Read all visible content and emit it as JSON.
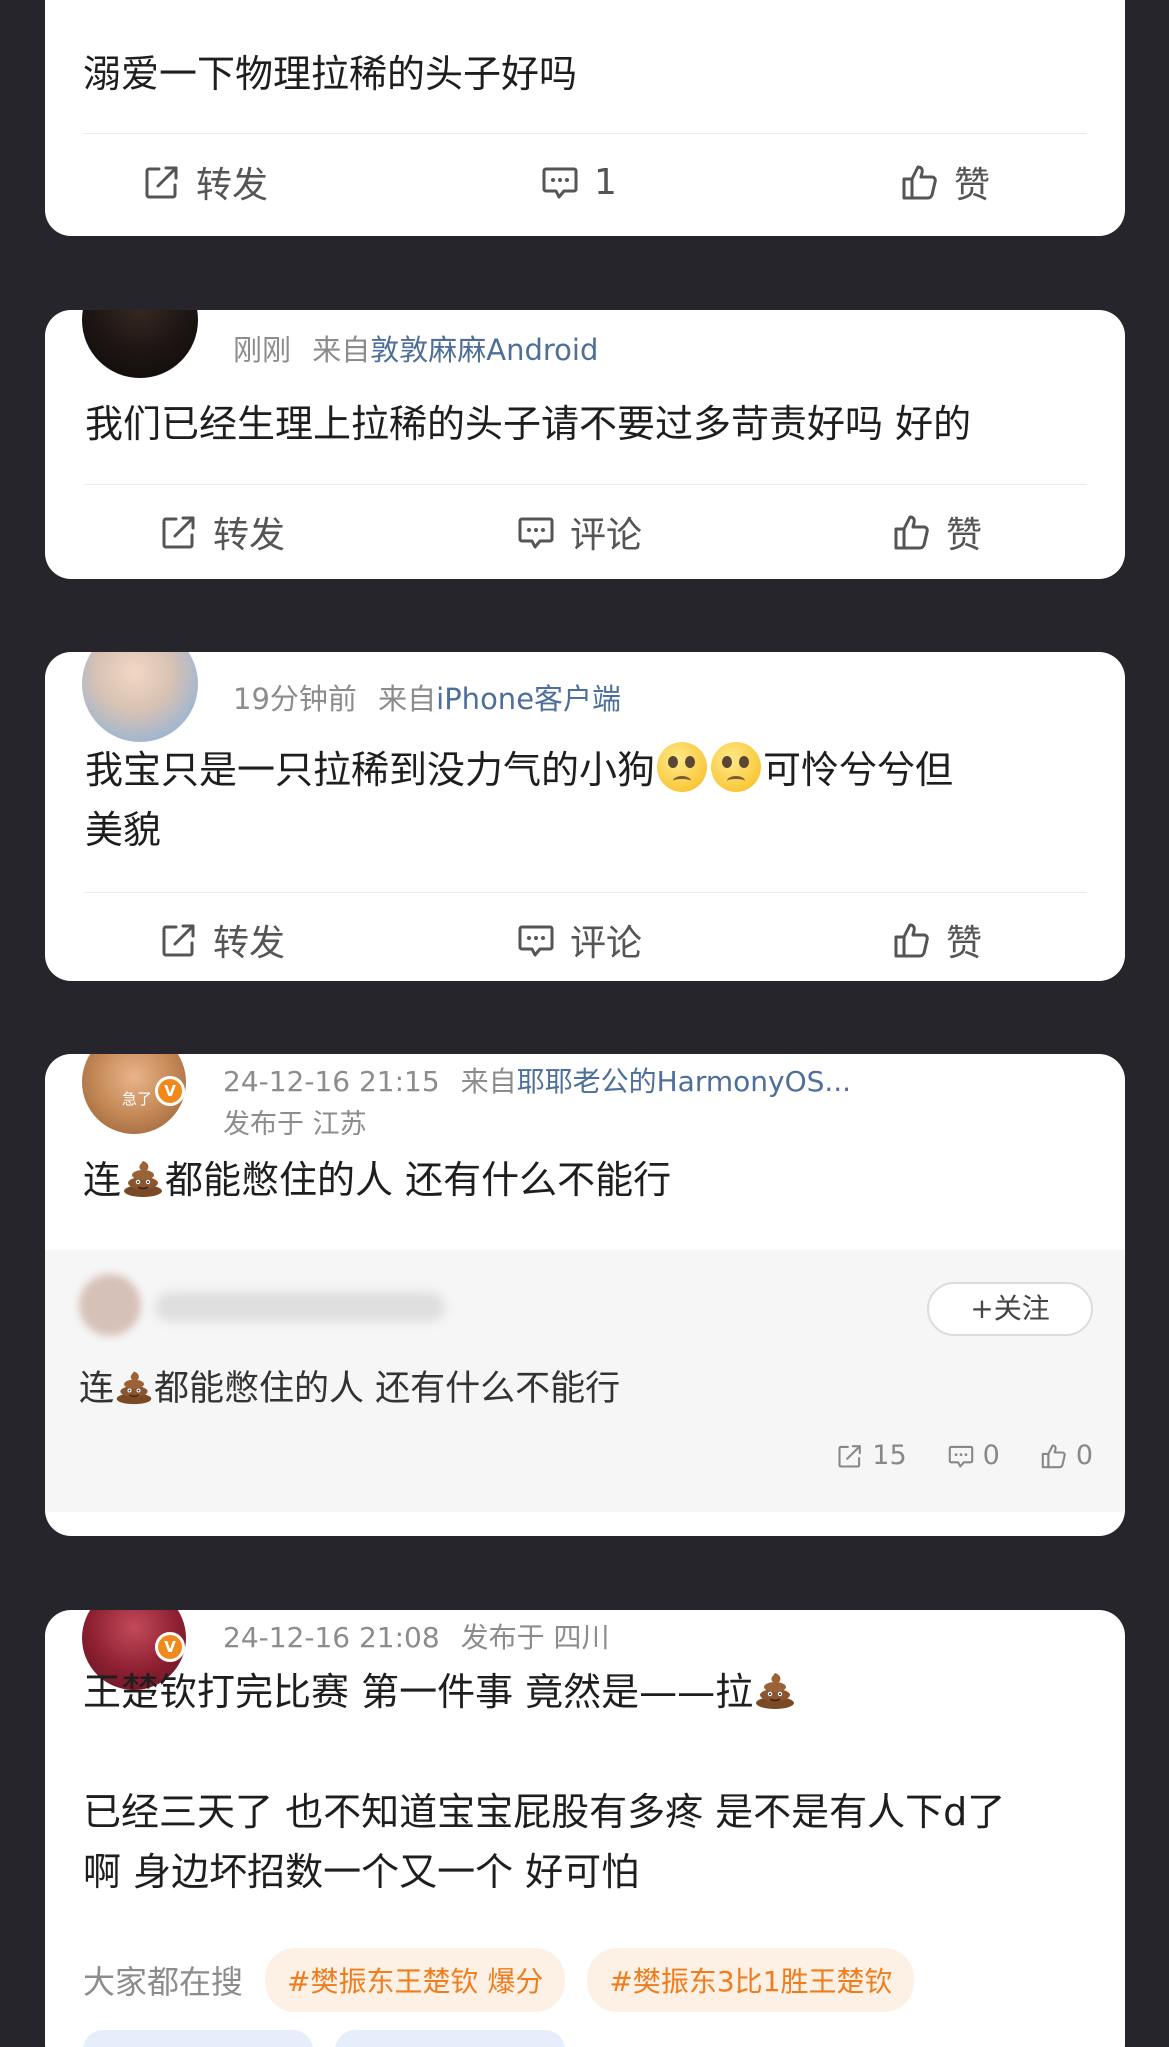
{
  "posts": [
    {
      "text": "溺爱一下物理拉稀的头子好吗",
      "actions": {
        "repost": "转发",
        "comment": "1",
        "like": "赞"
      }
    },
    {
      "time": "刚刚",
      "source_prefix": "来自",
      "source": "敦敦麻麻Android",
      "text": "我们已经生理上拉稀的头子请不要过多苛责好吗 好的",
      "actions": {
        "repost": "转发",
        "comment": "评论",
        "like": "赞"
      }
    },
    {
      "time": "19分钟前",
      "source_prefix": "来自",
      "source": "iPhone客户端",
      "text_a": "我宝只是一只拉稀到没力气的小狗",
      "text_b": "可怜兮兮但",
      "text_c": "美貌",
      "actions": {
        "repost": "转发",
        "comment": "评论",
        "like": "赞"
      }
    },
    {
      "avatar_text": "急了",
      "verified_badge": "V",
      "time": "24-12-16 21:15",
      "source_prefix": "来自",
      "source": "耶耶老公的HarmonyOS...",
      "location": "发布于 江苏",
      "text_a": "连",
      "text_b": "都能憋住的人 还有什么不能行",
      "repost": {
        "follow_label": "+关注",
        "text_a": "连",
        "text_b": "都能憋住的人 还有什么不能行",
        "repost_count": "15",
        "comment_count": "0",
        "like_count": "0"
      }
    },
    {
      "verified_badge": "V",
      "time": "24-12-16 21:08",
      "location": "发布于 四川",
      "text_line1": "王楚钦打完比赛 第一件事 竟然是——拉",
      "text_line2": "已经三天了 也不知道宝宝屁股有多疼 是不是有人下d了",
      "text_line3": "啊 身边坏招数一个又一个 好可怕",
      "search_label": "大家都在搜",
      "tags": [
        "#樊振东王楚钦 爆分",
        "#樊振东3比1胜王楚钦"
      ]
    }
  ],
  "icons": {
    "repost": "repost-icon",
    "comment": "comment-icon",
    "like": "thumbs-up-icon",
    "poop": "poop-emoji",
    "sad": "pleading-face-emoji"
  },
  "colors": {
    "background": "#26252b",
    "card": "#ffffff",
    "source_link": "#4e6f99",
    "tag_text": "#f07d1d",
    "verified": "#f08a1c"
  }
}
